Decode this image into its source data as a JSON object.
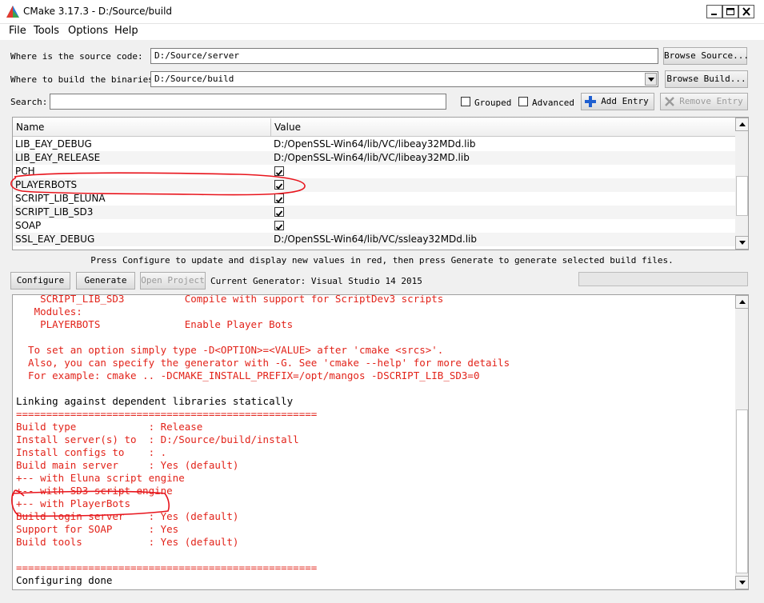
{
  "window": {
    "title": "CMake 3.17.3 - D:/Source/build"
  },
  "menu": [
    "File",
    "Tools",
    "Options",
    "Help"
  ],
  "source": {
    "label": "Where is the source code:",
    "value": "D:/Source/server",
    "browse_label": "Browse Source..."
  },
  "build": {
    "label": "Where to build the binaries:",
    "value": "D:/Source/build",
    "browse_label": "Browse Build..."
  },
  "search": {
    "label": "Search:",
    "value": "",
    "grouped_label": "Grouped",
    "advanced_label": "Advanced",
    "add_entry_label": "Add Entry",
    "remove_entry_label": "Remove Entry"
  },
  "table": {
    "col_name": "Name",
    "col_value": "Value",
    "rows": [
      {
        "name": "LIB_EAY_DEBUG",
        "value": "D:/OpenSSL-Win64/lib/VC/libeay32MDd.lib"
      },
      {
        "name": "LIB_EAY_RELEASE",
        "value": "D:/OpenSSL-Win64/lib/VC/libeay32MD.lib"
      },
      {
        "name": "PCH",
        "checked": true
      },
      {
        "name": "PLAYERBOTS",
        "checked": true
      },
      {
        "name": "SCRIPT_LIB_ELUNA",
        "checked": true
      },
      {
        "name": "SCRIPT_LIB_SD3",
        "checked": true
      },
      {
        "name": "SOAP",
        "checked": true
      },
      {
        "name": "SSL_EAY_DEBUG",
        "value": "D:/OpenSSL-Win64/lib/VC/ssleay32MDd.lib"
      }
    ]
  },
  "hint": "Press Configure to update and display new values in red, then press Generate to generate selected build files.",
  "actions": {
    "configure_label": "Configure",
    "generate_label": "Generate",
    "open_project_label": "Open Project",
    "generator_text": "Current Generator: Visual Studio 14 2015"
  },
  "output_lines": [
    {
      "text": "    SCRIPT_LIB_SD3          Compile with support for ScriptDev3 scripts",
      "color": "red"
    },
    {
      "text": "   Modules:",
      "color": "red"
    },
    {
      "text": "    PLAYERBOTS              Enable Player Bots",
      "color": "red"
    },
    {
      "text": "",
      "color": "red"
    },
    {
      "text": "  To set an option simply type -D<OPTION>=<VALUE> after 'cmake <srcs>'.",
      "color": "red"
    },
    {
      "text": "  Also, you can specify the generator with -G. See 'cmake --help' for more details",
      "color": "red"
    },
    {
      "text": "  For example: cmake .. -DCMAKE_INSTALL_PREFIX=/opt/mangos -DSCRIPT_LIB_SD3=0",
      "color": "red"
    },
    {
      "text": "",
      "color": "red"
    },
    {
      "text": "Linking against dependent libraries statically",
      "color": "black"
    },
    {
      "text": "==================================================",
      "color": "red"
    },
    {
      "text": "Build type            : Release",
      "color": "red"
    },
    {
      "text": "Install server(s) to  : D:/Source/build/install",
      "color": "red"
    },
    {
      "text": "Install configs to    : .",
      "color": "red"
    },
    {
      "text": "Build main server     : Yes (default)",
      "color": "red"
    },
    {
      "text": "+-- with Eluna script engine",
      "color": "red"
    },
    {
      "text": "+-- with SD3 script engine",
      "color": "red"
    },
    {
      "text": "+-- with PlayerBots",
      "color": "red"
    },
    {
      "text": "Build login server    : Yes (default)",
      "color": "red"
    },
    {
      "text": "Support for SOAP      : Yes",
      "color": "red"
    },
    {
      "text": "Build tools           : Yes (default)",
      "color": "red"
    },
    {
      "text": "",
      "color": "red"
    },
    {
      "text": "==================================================",
      "color": "red"
    },
    {
      "text": "Configuring done",
      "color": "black"
    }
  ],
  "colors": {
    "output_red": "#e2231a",
    "annotation_red": "#e8141c"
  }
}
